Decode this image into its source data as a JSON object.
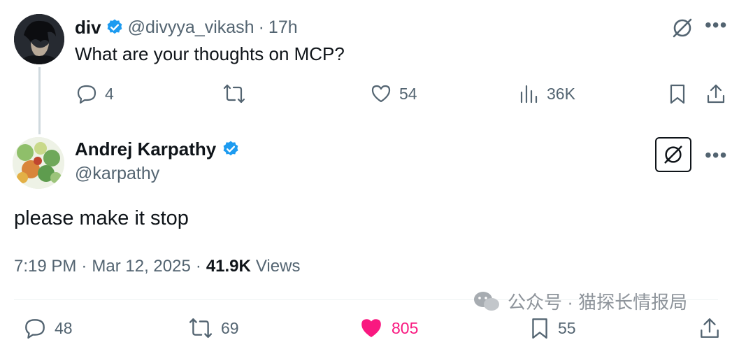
{
  "parent_tweet": {
    "display_name": "div",
    "handle": "@divyya_vikash",
    "separator": "·",
    "time": "17h",
    "text": "What are your thoughts on MCP?",
    "replies": "4",
    "likes": "54",
    "views": "36K"
  },
  "main_tweet": {
    "display_name": "Andrej Karpathy",
    "handle": "@karpathy",
    "text": "please make it stop",
    "time": "7:19 PM",
    "dot1": "·",
    "date": "Mar 12, 2025",
    "dot2": "·",
    "views_count": "41.9K",
    "views_label": "Views",
    "replies": "48",
    "reposts": "69",
    "likes": "805",
    "bookmarks": "55"
  },
  "watermark": {
    "text": "公众号 · 猫探长情报局"
  },
  "icons": {
    "verified": "verified-badge-icon",
    "grok": "grok-icon",
    "more": "more-icon",
    "reply": "reply-icon",
    "repost": "repost-icon",
    "like": "like-icon",
    "views": "views-icon",
    "bookmark": "bookmark-icon",
    "share": "share-icon"
  },
  "colors": {
    "verified": "#1d9bf0",
    "like_active": "#f91880",
    "text": "#0f1419",
    "muted": "#536471"
  }
}
